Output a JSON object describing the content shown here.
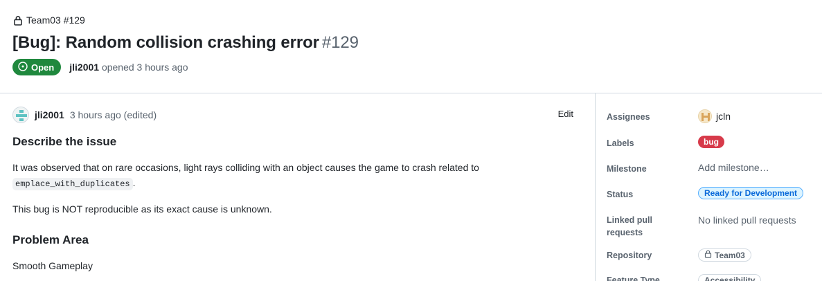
{
  "breadcrumb": {
    "repo_text": "Team03 #129"
  },
  "issue": {
    "title": "[Bug]: Random collision crashing error",
    "number": "#129",
    "state": "Open",
    "author": "jli2001",
    "opened_text": "opened 3 hours ago"
  },
  "comment": {
    "author": "jli2001",
    "time": "3 hours ago (edited)",
    "edit_label": "Edit",
    "heading_1": "Describe the issue",
    "para_1": "It was observed that on rare occasions, light rays colliding with an object causes the game to crash related to",
    "code_1": "emplace_with_duplicates",
    "para_1_end": ".",
    "para_2": "This bug is NOT reproducible as its exact cause is unknown.",
    "heading_2": "Problem Area",
    "para_3": "Smooth Gameplay"
  },
  "sidebar": {
    "assignees_label": "Assignees",
    "assignee": "jcln",
    "labels_label": "Labels",
    "label_bug": "bug",
    "milestone_label": "Milestone",
    "milestone_value": "Add milestone…",
    "status_label": "Status",
    "status_value": "Ready for Development",
    "linked_label": "Linked pull requests",
    "linked_value": "No linked pull requests",
    "repository_label": "Repository",
    "repository_value": "Team03",
    "feature_label": "Feature Type",
    "feature_value": "Accessibility"
  },
  "colors": {
    "open_green": "#1f883d",
    "bug_red": "#d73a4a",
    "status_blue": "#0969da"
  },
  "icons": [
    "lock-icon",
    "issue-open-icon",
    "user-avatar",
    "repo-lock-icon"
  ]
}
